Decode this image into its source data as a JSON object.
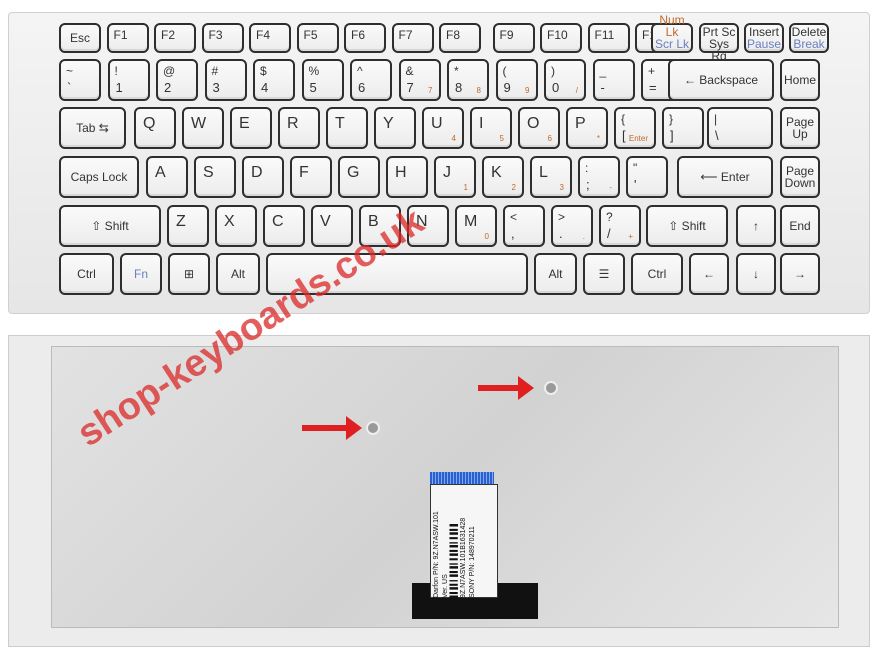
{
  "keyboard": {
    "rows": [
      [
        {
          "m": "Esc"
        },
        {
          "t": "F1"
        },
        {
          "t": "F2"
        },
        {
          "t": "F3"
        },
        {
          "t": "F4"
        },
        {
          "t": "F5"
        },
        {
          "t": "F6"
        },
        {
          "t": "F7"
        },
        {
          "t": "F8"
        },
        {
          "t": "F9"
        },
        {
          "t": "F10"
        },
        {
          "t": "F11"
        },
        {
          "t": "F12"
        },
        {
          "m": "Num Lk",
          "m2": "Scr Lk",
          "c": "orange",
          "c2": "blue"
        },
        {
          "m": "Prt Sc",
          "m2": "Sys Rq"
        },
        {
          "m": "Insert",
          "m2": "Pause",
          "c2": "blue"
        },
        {
          "m": "Delete",
          "m2": "Break",
          "c2": "blue"
        }
      ],
      [
        {
          "t": "~",
          "b": "`"
        },
        {
          "t": "!",
          "b": "1"
        },
        {
          "t": "@",
          "b": "2"
        },
        {
          "t": "#",
          "b": "3"
        },
        {
          "t": "$",
          "b": "4"
        },
        {
          "t": "%",
          "b": "5"
        },
        {
          "t": "^",
          "b": "6"
        },
        {
          "t": "&",
          "b": "7",
          "s": "7"
        },
        {
          "t": "*",
          "b": "8",
          "s": "8"
        },
        {
          "t": "(",
          "b": "9",
          "s": "9"
        },
        {
          "t": ")",
          "b": "0",
          "s": "/"
        },
        {
          "t": "_",
          "b": "-"
        },
        {
          "t": "+",
          "b": "="
        },
        {
          "m": "← Backspace"
        },
        {
          "m": "Home"
        }
      ],
      [
        {
          "m": "Tab ⇆"
        },
        {
          "big": "Q"
        },
        {
          "big": "W"
        },
        {
          "big": "E"
        },
        {
          "big": "R"
        },
        {
          "big": "T"
        },
        {
          "big": "Y"
        },
        {
          "big": "U",
          "s": "4"
        },
        {
          "big": "I",
          "s": "5"
        },
        {
          "big": "O",
          "s": "6"
        },
        {
          "big": "P",
          "s": "*"
        },
        {
          "t": "{",
          "b": "[",
          "s": "Enter"
        },
        {
          "t": "}",
          "b": "]"
        },
        {
          "t": "|",
          "b": "\\"
        },
        {
          "m": "Page",
          "m2": "Up"
        }
      ],
      [
        {
          "m": "Caps Lock"
        },
        {
          "big": "A"
        },
        {
          "big": "S"
        },
        {
          "big": "D"
        },
        {
          "big": "F"
        },
        {
          "big": "G"
        },
        {
          "big": "H"
        },
        {
          "big": "J",
          "s": "1"
        },
        {
          "big": "K",
          "s": "2"
        },
        {
          "big": "L",
          "s": "3"
        },
        {
          "t": ":",
          "b": ";",
          "s": "-"
        },
        {
          "t": "\"",
          "b": "'"
        },
        {
          "m": "⟵ Enter"
        },
        {
          "m": "Page",
          "m2": "Down"
        }
      ],
      [
        {
          "m": "⇧ Shift"
        },
        {
          "big": "Z"
        },
        {
          "big": "X"
        },
        {
          "big": "C"
        },
        {
          "big": "V"
        },
        {
          "big": "B"
        },
        {
          "big": "N"
        },
        {
          "big": "M",
          "s": "0"
        },
        {
          "t": "<",
          "b": ","
        },
        {
          "t": ">",
          "b": ".",
          "s": "."
        },
        {
          "t": "?",
          "b": "/",
          "s": "+"
        },
        {
          "m": "⇧ Shift"
        },
        {
          "m": "↑"
        },
        {
          "m": "End"
        }
      ],
      [
        {
          "m": "Ctrl"
        },
        {
          "m": "Fn",
          "c": "blue"
        },
        {
          "m": "⊞"
        },
        {
          "m": "Alt"
        },
        {
          "m": ""
        },
        {
          "m": "Alt"
        },
        {
          "m": "☰"
        },
        {
          "m": "Ctrl"
        },
        {
          "m": "←"
        },
        {
          "m": "↓"
        },
        {
          "m": "→"
        }
      ]
    ]
  },
  "part_label": {
    "lines": [
      "Darfon P/N: 9Z.N7ASW.101",
      "Ver. US",
      "9Z.N7ASW.101B1631428",
      "SONY P/N: 148970211"
    ]
  },
  "watermark": "shop-keyboards.co.uk",
  "colors": {
    "arrow": "#e02020",
    "numpad_legend": "#c26a2a",
    "fn_legend": "#6a7fc0"
  }
}
